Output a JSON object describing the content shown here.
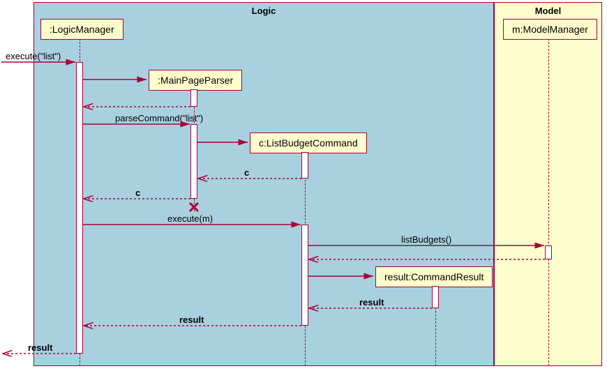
{
  "regions": {
    "logic": "Logic",
    "model": "Model"
  },
  "participants": {
    "logicManager": ":LogicManager",
    "mainPageParser": ":MainPageParser",
    "listBudgetCommand": "c:ListBudgetCommand",
    "commandResult": "result:CommandResult",
    "modelManager": "m:ModelManager"
  },
  "messages": {
    "executeList": "execute(\"list\")",
    "parseCommand": "parseCommand(\"list\")",
    "returnC1": "c",
    "returnC2": "c",
    "executeM": "execute(m)",
    "listBudgets": "listBudgets()",
    "returnResult1": "result",
    "returnResult2": "result",
    "returnResult3": "result"
  },
  "chart_data": {
    "type": "sequence-diagram",
    "regions": [
      {
        "name": "Logic",
        "participants": [
          ":LogicManager",
          ":MainPageParser",
          "c:ListBudgetCommand",
          "result:CommandResult"
        ]
      },
      {
        "name": "Model",
        "participants": [
          "m:ModelManager"
        ]
      }
    ],
    "participants": [
      {
        "id": "ext",
        "name": "(external)"
      },
      {
        "id": "lm",
        "name": ":LogicManager"
      },
      {
        "id": "mpp",
        "name": ":MainPageParser",
        "created_by_msg": 2
      },
      {
        "id": "lbc",
        "name": "c:ListBudgetCommand",
        "created_by_msg": 4
      },
      {
        "id": "cr",
        "name": "result:CommandResult",
        "created_by_msg": 9
      },
      {
        "id": "mm",
        "name": "m:ModelManager"
      }
    ],
    "messages": [
      {
        "n": 1,
        "from": "ext",
        "to": "lm",
        "label": "execute(\"list\")",
        "kind": "call"
      },
      {
        "n": 2,
        "from": "lm",
        "to": "mpp",
        "label": "",
        "kind": "create"
      },
      {
        "n": 3,
        "from": "mpp",
        "to": "lm",
        "label": "",
        "kind": "return"
      },
      {
        "n": 4,
        "from": "lm",
        "to": "mpp",
        "label": "parseCommand(\"list\")",
        "kind": "call"
      },
      {
        "n": 5,
        "from": "mpp",
        "to": "lbc",
        "label": "",
        "kind": "create"
      },
      {
        "n": 6,
        "from": "lbc",
        "to": "mpp",
        "label": "c",
        "kind": "return"
      },
      {
        "n": 7,
        "from": "mpp",
        "to": "lm",
        "label": "c",
        "kind": "return",
        "destroys": "mpp"
      },
      {
        "n": 8,
        "from": "lm",
        "to": "lbc",
        "label": "execute(m)",
        "kind": "call"
      },
      {
        "n": 9,
        "from": "lbc",
        "to": "mm",
        "label": "listBudgets()",
        "kind": "call"
      },
      {
        "n": 10,
        "from": "mm",
        "to": "lbc",
        "label": "",
        "kind": "return"
      },
      {
        "n": 11,
        "from": "lbc",
        "to": "cr",
        "label": "",
        "kind": "create"
      },
      {
        "n": 12,
        "from": "cr",
        "to": "lbc",
        "label": "result",
        "kind": "return"
      },
      {
        "n": 13,
        "from": "lbc",
        "to": "lm",
        "label": "result",
        "kind": "return"
      },
      {
        "n": 14,
        "from": "lm",
        "to": "ext",
        "label": "result",
        "kind": "return"
      }
    ]
  }
}
